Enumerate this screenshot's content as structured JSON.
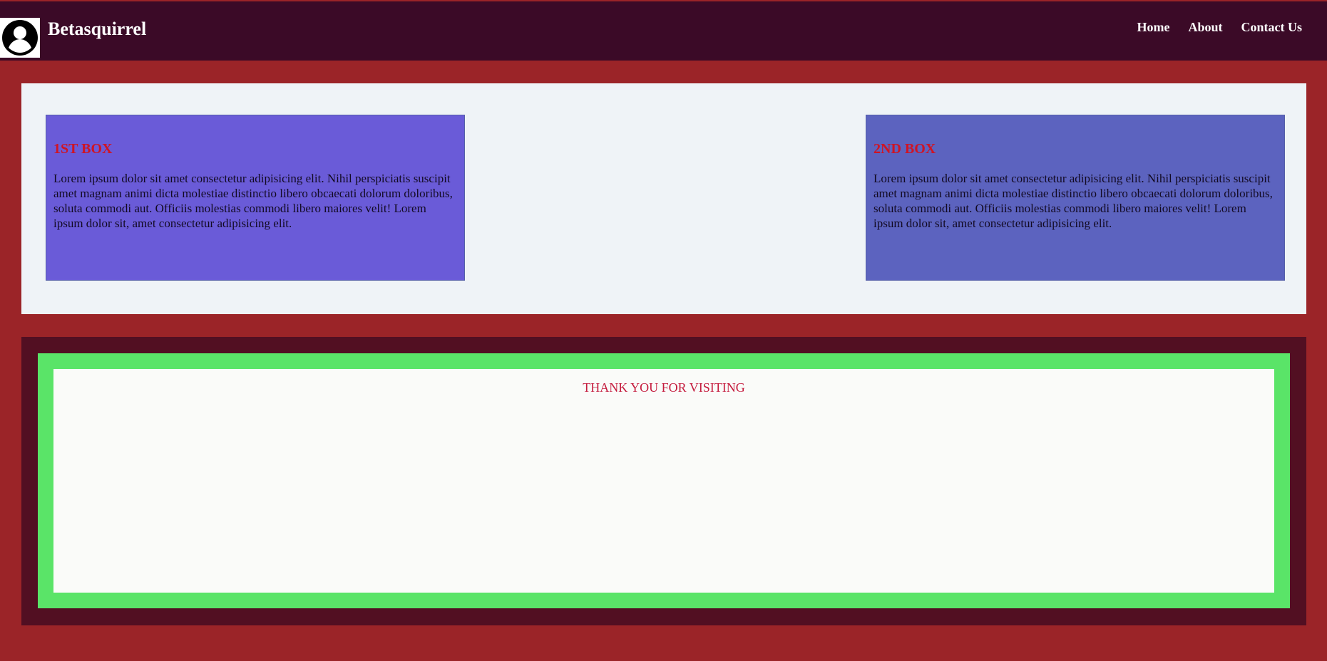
{
  "header": {
    "brand": "Betasquirrel",
    "logo_icon": "user-avatar-icon",
    "nav": [
      {
        "label": "Home"
      },
      {
        "label": "About"
      },
      {
        "label": "Contact Us"
      }
    ]
  },
  "main": {
    "boxes": [
      {
        "title": "1ST BOX",
        "text": "Lorem ipsum dolor sit amet consectetur adipisicing elit. Nihil perspiciatis suscipit amet magnam animi dicta molestiae distinctio libero obcaecati dolorum doloribus, soluta commodi aut. Officiis molestias commodi libero maiores velit! Lorem ipsum dolor sit, amet consectetur adipisicing elit."
      },
      {
        "title": "2ND BOX",
        "text": "Lorem ipsum dolor sit amet consectetur adipisicing elit. Nihil perspiciatis suscipit amet magnam animi dicta molestiae distinctio libero obcaecati dolorum doloribus, soluta commodi aut. Officiis molestias commodi libero maiores velit! Lorem ipsum dolor sit, amet consectetur adipisicing elit."
      }
    ]
  },
  "footer": {
    "message": "THANK YOU FOR VISITING"
  },
  "colors": {
    "page_background": "#9b2428",
    "navbar": "#3b0a27",
    "box_1": "#6a5bd8",
    "box_2": "#5c63bf",
    "box_title": "#cf1424",
    "footer_frame": "#520f22",
    "footer_border": "#5ae468",
    "footer_text": "#c41b3d"
  }
}
